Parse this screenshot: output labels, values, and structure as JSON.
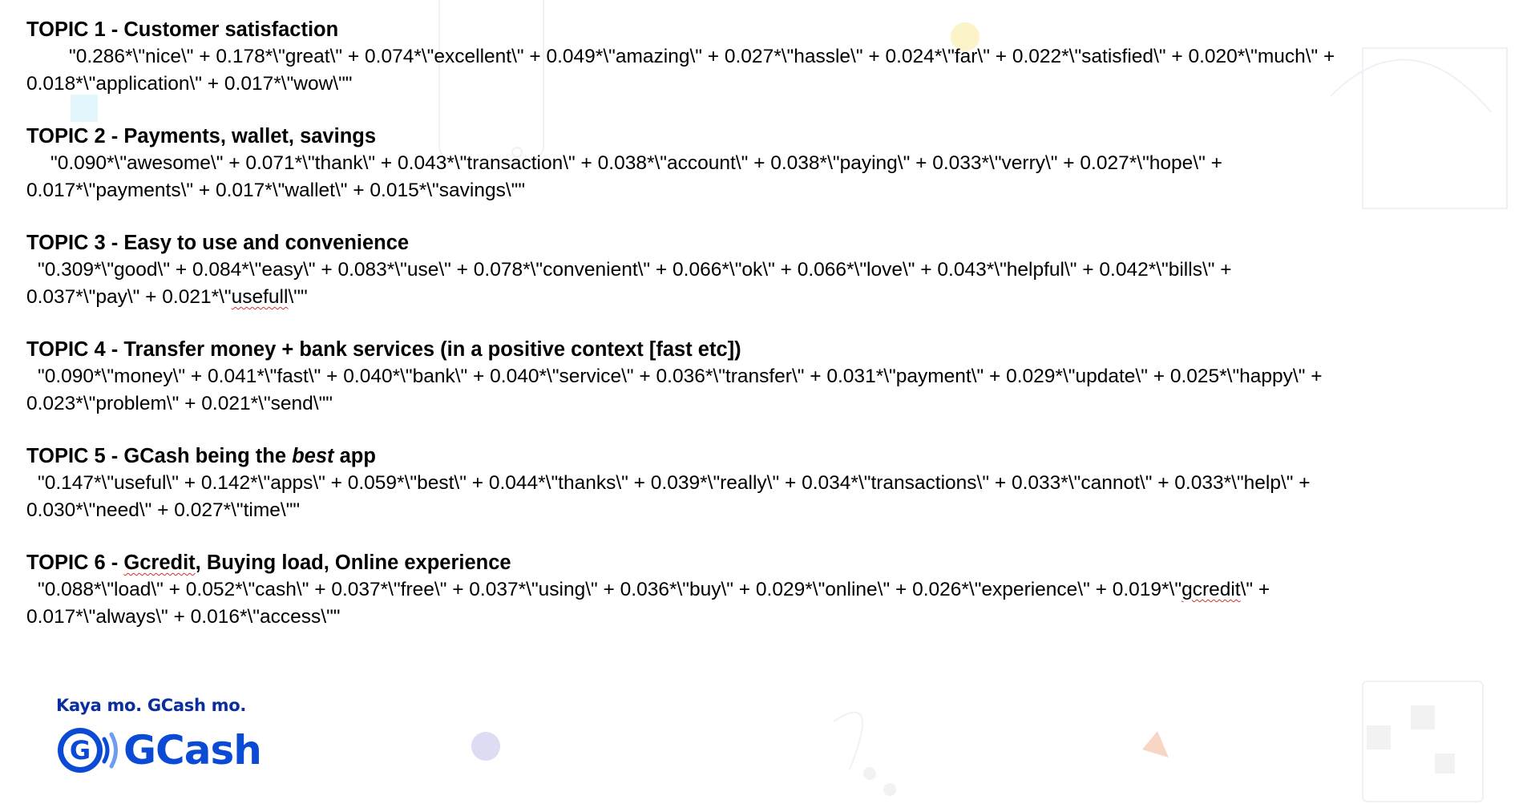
{
  "topics": [
    {
      "number_label": "TOPIC 1 - ",
      "name": "Customer satisfaction",
      "line1": "\"0.286*\\\"nice\\\" + 0.178*\\\"great\\\" + 0.074*\\\"excellent\\\" + 0.049*\\\"amazing\\\" + 0.027*\\\"hassle\\\" + 0.024*\\\"far\\\" + 0.022*\\\"satisfied\\\" + 0.020*\\\"much\\\" +",
      "line2": "0.018*\\\"application\\\" + 0.017*\\\"wow\\\"\""
    },
    {
      "number_label": "TOPIC 2 - ",
      "name": "Payments, wallet, savings",
      "line1": "\"0.090*\\\"awesome\\\" + 0.071*\\\"thank\\\" + 0.043*\\\"transaction\\\" + 0.038*\\\"account\\\" + 0.038*\\\"paying\\\" + 0.033*\\\"verry\\\" + 0.027*\\\"hope\\\" +",
      "line2": "0.017*\\\"payments\\\" + 0.017*\\\"wallet\\\" + 0.015*\\\"savings\\\"\""
    },
    {
      "number_label": "TOPIC 3 - ",
      "name": "Easy to use and convenience",
      "line1": "\"0.309*\\\"good\\\" + 0.084*\\\"easy\\\" + 0.083*\\\"use\\\" + 0.078*\\\"convenient\\\" + 0.066*\\\"ok\\\" + 0.066*\\\"love\\\" + 0.043*\\\"helpful\\\" + 0.042*\\\"bills\\\" +",
      "line2_pre": "0.037*\\\"pay\\\" + 0.021*\\\"",
      "line2_mark": "usefull",
      "line2_post": "\\\"\""
    },
    {
      "number_label": "TOPIC 4 - ",
      "name": "Transfer money + bank services (in a positive context [fast etc])",
      "line1": "\"0.090*\\\"money\\\" + 0.041*\\\"fast\\\" + 0.040*\\\"bank\\\" + 0.040*\\\"service\\\" + 0.036*\\\"transfer\\\" + 0.031*\\\"payment\\\" + 0.029*\\\"update\\\" + 0.025*\\\"happy\\\" +",
      "line2": "0.023*\\\"problem\\\" + 0.021*\\\"send\\\"\""
    },
    {
      "number_label": "TOPIC 5 - ",
      "name_pre": "GCash being the ",
      "name_em": "best",
      "name_post": " app",
      "line1": "\"0.147*\\\"useful\\\" + 0.142*\\\"apps\\\" + 0.059*\\\"best\\\" + 0.044*\\\"thanks\\\" + 0.039*\\\"really\\\" + 0.034*\\\"transactions\\\" + 0.033*\\\"cannot\\\" + 0.033*\\\"help\\\" +",
      "line2": "0.030*\\\"need\\\" + 0.027*\\\"time\\\"\""
    },
    {
      "number_label": "TOPIC 6 - ",
      "name_mark": "Gcredit",
      "name_rest": ", Buying load, Online experience",
      "line1_pre": "\"0.088*\\\"load\\\" + 0.052*\\\"cash\\\" + 0.037*\\\"free\\\" + 0.037*\\\"using\\\" + 0.036*\\\"buy\\\" + 0.029*\\\"online\\\" + 0.026*\\\"experience\\\" + 0.019*\\\"",
      "line1_mark": "gcredit",
      "line1_post": "\\\" +",
      "line2": "0.017*\\\"always\\\" + 0.016*\\\"access\\\"\""
    }
  ],
  "brand": {
    "tagline": "Kaya mo. GCash mo.",
    "logo_text": "GCash",
    "logo_icon": "gcash-g-icon",
    "color": "#0a4ad4"
  }
}
